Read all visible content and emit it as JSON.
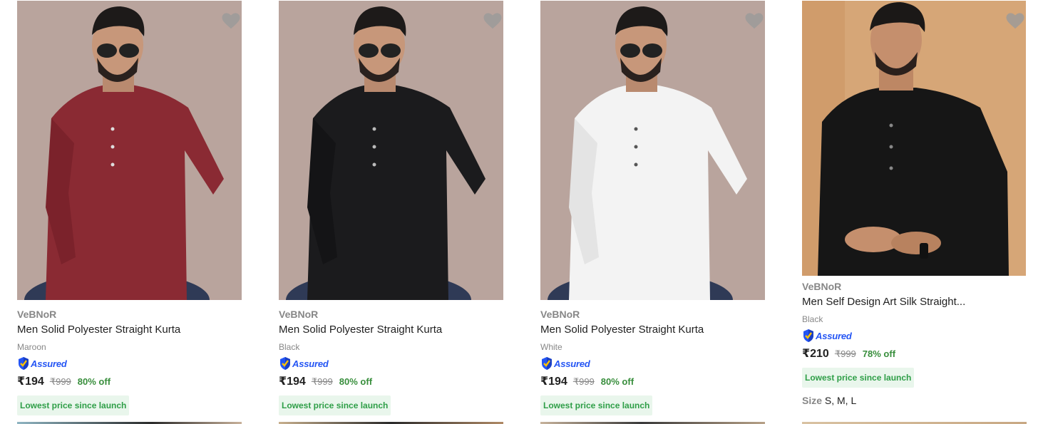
{
  "products": [
    {
      "brand": "VeBNoR",
      "title": "Men Solid Polyester Straight Kurta",
      "color": "Maroon",
      "assured": "Assured",
      "price": "₹194",
      "mrp": "₹999",
      "discount": "80% off",
      "tag": "Lowest price since launch",
      "shirt_color": "#8a2a33",
      "bg_color": "#b9a49d"
    },
    {
      "brand": "VeBNoR",
      "title": "Men Solid Polyester Straight Kurta",
      "color": "Black",
      "assured": "Assured",
      "price": "₹194",
      "mrp": "₹999",
      "discount": "80% off",
      "tag": "Lowest price since launch",
      "shirt_color": "#1b1b1d",
      "bg_color": "#b9a49d"
    },
    {
      "brand": "VeBNoR",
      "title": "Men Solid Polyester Straight Kurta",
      "color": "White",
      "assured": "Assured",
      "price": "₹194",
      "mrp": "₹999",
      "discount": "80% off",
      "tag": "Lowest price since launch",
      "shirt_color": "#f3f3f3",
      "bg_color": "#b9a49d"
    },
    {
      "brand": "VeBNoR",
      "title": "Men Self Design Art Silk Straight...",
      "color": "Black",
      "assured": "Assured",
      "price": "₹210",
      "mrp": "₹999",
      "discount": "78% off",
      "tag": "Lowest price since launch",
      "size_label": "Size",
      "sizes": "S, M, L",
      "shirt_color": "#161616",
      "bg_color": "#d6a677"
    }
  ],
  "icons": {
    "wishlist": "heart-icon",
    "assured_badge": "shield-check-icon"
  }
}
